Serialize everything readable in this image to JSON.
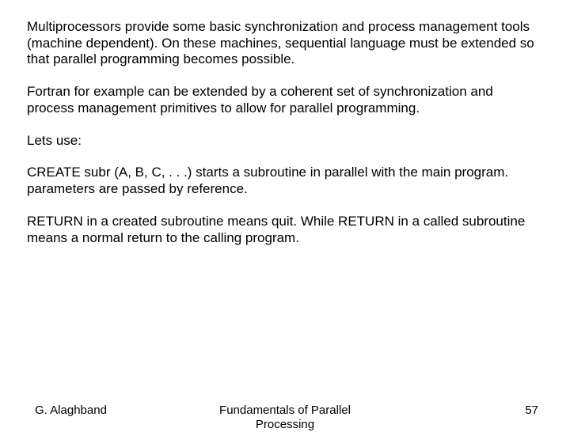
{
  "paragraphs": {
    "p1": "Multiprocessors provide some basic synchronization and process management tools (machine dependent).  On these machines, sequential language must be extended so that parallel programming becomes possible.",
    "p2": "Fortran for example can be extended by a coherent set of synchronization and process management primitives to allow for parallel programming.",
    "p3": "Lets use:",
    "p4": "CREATE subr (A, B, C, . . .)  starts a subroutine in parallel with the main program.  parameters are passed by reference.",
    "p5": "RETURN in a created subroutine means quit. While RETURN in a called subroutine means a normal return to the calling program."
  },
  "footer": {
    "author": "G. Alaghband",
    "title_line1": "Fundamentals of Parallel",
    "title_line2": "Processing",
    "page": "57"
  }
}
